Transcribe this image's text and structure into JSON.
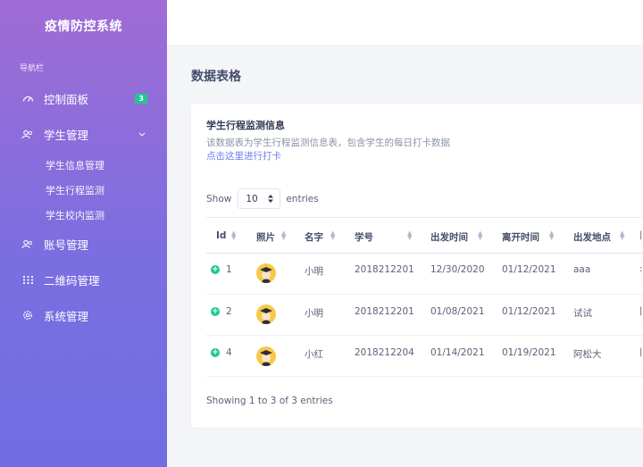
{
  "sidebar": {
    "brand": "疫情防控系统",
    "heading": "导航栏",
    "items": [
      {
        "label": "控制面板",
        "icon": "gauge-icon",
        "badge": "3"
      },
      {
        "label": "学生管理",
        "icon": "users-icon"
      },
      {
        "label": "账号管理",
        "icon": "account-icon"
      },
      {
        "label": "二维码管理",
        "icon": "grid-icon"
      },
      {
        "label": "系统管理",
        "icon": "gear-icon"
      }
    ],
    "sub_items": [
      "学生信息管理",
      "学生行程监测",
      "学生校内监测"
    ]
  },
  "page": {
    "title": "数据表格"
  },
  "card": {
    "title": "学生行程监测信息",
    "description": "该数据表为学生行程监测信息表，包含学生的每日打卡数据",
    "link": "点击这里进行打卡"
  },
  "table": {
    "show_label": "Show",
    "page_size": "10",
    "entries_label": "entries",
    "columns": [
      "Id",
      "照片",
      "名字",
      "学号",
      "出发时间",
      "离开时间",
      "出发地点"
    ],
    "rows": [
      {
        "id": "1",
        "name": "小明",
        "student_no": "2018212201",
        "depart_time": "12/30/2020",
        "leave_time": "01/12/2021",
        "location": "aaa"
      },
      {
        "id": "2",
        "name": "小明",
        "student_no": "2018212201",
        "depart_time": "01/08/2021",
        "leave_time": "01/12/2021",
        "location": "试试"
      },
      {
        "id": "4",
        "name": "小红",
        "student_no": "2018212204",
        "depart_time": "01/14/2021",
        "leave_time": "01/19/2021",
        "location": "阿松大"
      }
    ],
    "info": "Showing 1 to 3 of 3 entries"
  },
  "colors": {
    "accent": "#1fc98e",
    "sidebar_top": "#a06cd5",
    "sidebar_bottom": "#6f6de3",
    "link": "#6b7ee8"
  }
}
